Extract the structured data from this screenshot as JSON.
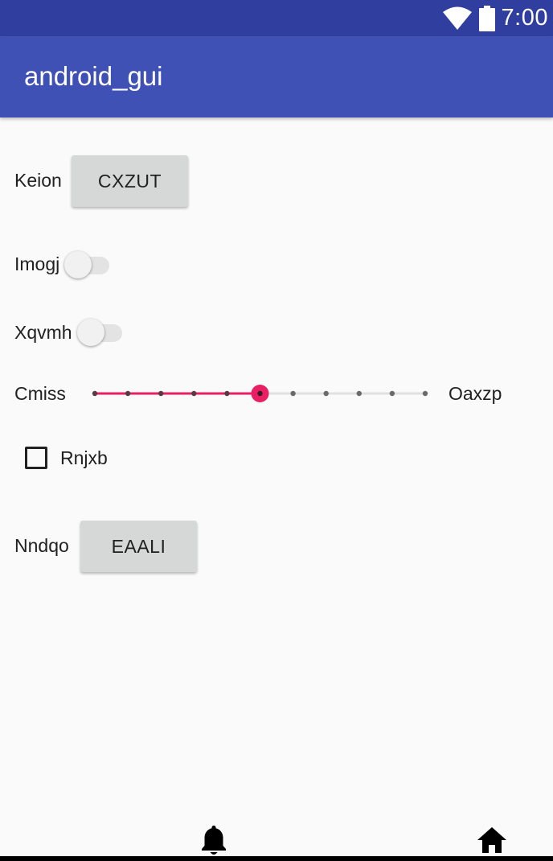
{
  "status_bar": {
    "time": "7:00",
    "icons": [
      "wifi-icon",
      "battery-icon"
    ],
    "color": "#303f9f"
  },
  "app_bar": {
    "title": "android_gui",
    "color": "#3f51b5"
  },
  "form": {
    "row1": {
      "label": "Keion",
      "button_label": "CXZUT"
    },
    "row2": {
      "label": "Imogj",
      "switch_on": false
    },
    "row3": {
      "label": "Xqvmh",
      "switch_on": false
    },
    "slider": {
      "left_label": "Cmiss",
      "right_label": "Oaxzp",
      "min": 0,
      "max": 10,
      "value": 5,
      "accent_color": "#e91e63"
    },
    "checkbox": {
      "label": "Rnjxb",
      "checked": false
    },
    "row6": {
      "label": "Nndqo",
      "button_label": "EAALI"
    }
  },
  "bottom_nav": {
    "icons": [
      "bell-icon",
      "home-icon"
    ]
  }
}
